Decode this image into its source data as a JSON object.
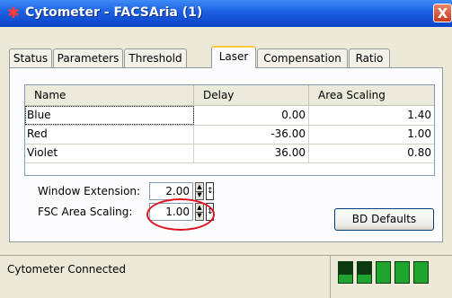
{
  "window": {
    "title": "Cytometer - FACSAria (1)",
    "title_icon": "asterisk-icon",
    "close_label": "X"
  },
  "tabs": [
    {
      "label": "Status",
      "active": false
    },
    {
      "label": "Parameters",
      "active": false
    },
    {
      "label": "Threshold",
      "active": false
    },
    {
      "label": "Laser",
      "active": true
    },
    {
      "label": "Compensation",
      "active": false
    },
    {
      "label": "Ratio",
      "active": false
    }
  ],
  "laser_table": {
    "columns": [
      "Name",
      "Delay",
      "Area Scaling"
    ],
    "rows": [
      {
        "name": "Blue",
        "delay": "0.00",
        "area_scaling": "1.40"
      },
      {
        "name": "Red",
        "delay": "-36.00",
        "area_scaling": "1.00"
      },
      {
        "name": "Violet",
        "delay": "36.00",
        "area_scaling": "0.80"
      }
    ]
  },
  "window_extension": {
    "label": "Window Extension:",
    "value": "2.00"
  },
  "fsc_area_scaling": {
    "label": "FSC Area Scaling:",
    "value": "1.00"
  },
  "bd_defaults_label": "BD Defaults",
  "status": {
    "text": "Cytometer Connected",
    "indicators": [
      "dark",
      "dark",
      "green",
      "green",
      "green"
    ]
  },
  "colors": {
    "highlight": "#E0141E",
    "led_green": "#1FA52F",
    "titlebar": "#0A44C8"
  }
}
